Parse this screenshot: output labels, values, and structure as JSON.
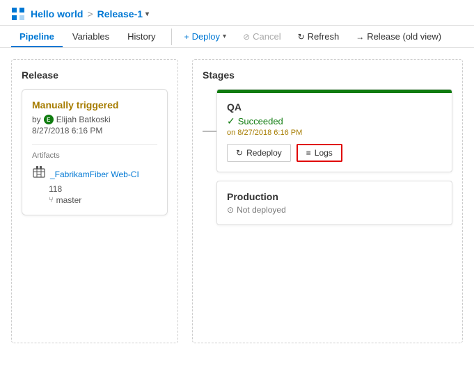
{
  "header": {
    "app_icon": "🔷",
    "breadcrumb_app": "Hello world",
    "breadcrumb_sep": ">",
    "breadcrumb_release": "Release-1",
    "chevron": "▾"
  },
  "nav": {
    "tabs": [
      {
        "id": "pipeline",
        "label": "Pipeline",
        "active": true
      },
      {
        "id": "variables",
        "label": "Variables",
        "active": false
      },
      {
        "id": "history",
        "label": "History",
        "active": false
      }
    ],
    "actions": [
      {
        "id": "deploy",
        "label": "Deploy",
        "icon": "+",
        "type": "deploy"
      },
      {
        "id": "cancel",
        "label": "Cancel",
        "icon": "⊘",
        "type": "disabled"
      },
      {
        "id": "refresh",
        "label": "Refresh",
        "icon": "↻",
        "type": "normal"
      },
      {
        "id": "old-view",
        "label": "Release (old view)",
        "icon": "→",
        "type": "normal"
      }
    ]
  },
  "release_panel": {
    "title": "Release",
    "card": {
      "trigger": "Manually triggered",
      "by_label": "by",
      "user_initial": "E",
      "user_name": "Elijah Batkoski",
      "date": "8/27/2018 6:16 PM",
      "artifacts_label": "Artifacts",
      "artifact_icon": "🏗",
      "artifact_name": "_FabrikamFiber Web-CI",
      "artifact_build": "118",
      "artifact_branch": "master"
    }
  },
  "stages_panel": {
    "title": "Stages",
    "stages": [
      {
        "id": "qa",
        "name": "QA",
        "status": "Succeeded",
        "status_type": "succeeded",
        "date": "on 8/27/2018 6:16 PM",
        "actions": [
          {
            "id": "redeploy",
            "label": "Redeploy",
            "icon": "↻"
          },
          {
            "id": "logs",
            "label": "Logs",
            "icon": "≡",
            "highlighted": true
          }
        ]
      },
      {
        "id": "production",
        "name": "Production",
        "status": "Not deployed",
        "status_type": "not-deployed",
        "actions": []
      }
    ]
  }
}
